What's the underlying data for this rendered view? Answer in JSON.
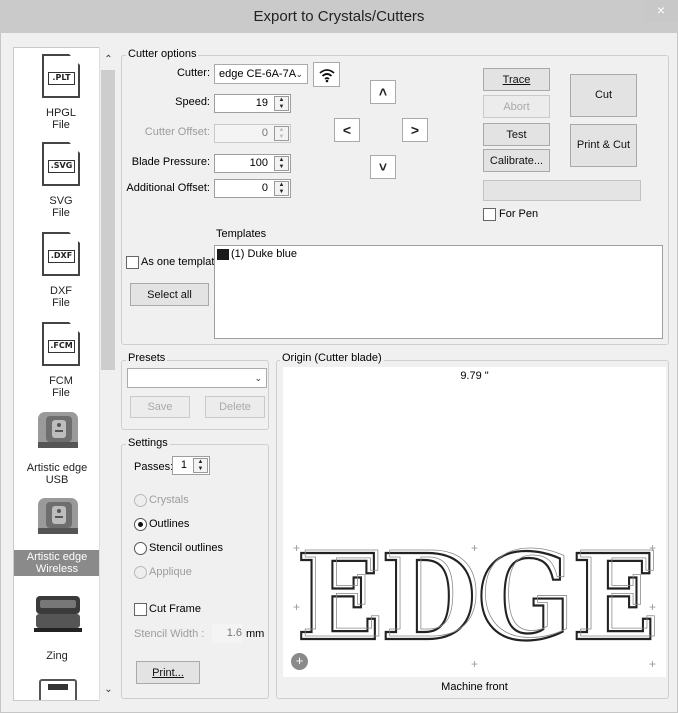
{
  "window": {
    "title": "Export to Crystals/Cutters",
    "close": "×"
  },
  "sidebar": {
    "items": [
      {
        "label": "HPGL",
        "sub": "File",
        "tag": ".PLT"
      },
      {
        "label": "SVG",
        "sub": "File",
        "tag": ".SVG"
      },
      {
        "label": "DXF",
        "sub": "File",
        "tag": ".DXF"
      },
      {
        "label": "FCM",
        "sub": "File",
        "tag": ".FCM"
      },
      {
        "label": "Artistic edge",
        "sub": "USB"
      },
      {
        "label": "Artistic edge",
        "sub": "Wireless",
        "selected": true
      },
      {
        "label": "Zing",
        "sub": ""
      }
    ]
  },
  "cutter_options": {
    "legend": "Cutter options",
    "cutter_label": "Cutter:",
    "cutter_value": "edge CE-6A-7A",
    "speed_label": "Speed:",
    "speed_value": "19",
    "cutter_offset_label": "Cutter Offset:",
    "cutter_offset_value": "0",
    "blade_pressure_label": "Blade Pressure:",
    "blade_pressure_value": "100",
    "additional_offset_label": "Additional Offset:",
    "additional_offset_value": "0",
    "trace": "Trace",
    "abort": "Abort",
    "test": "Test",
    "calibrate": "Calibrate...",
    "cut": "Cut",
    "print_cut": "Print & Cut",
    "for_pen": "For Pen",
    "templates_label": "Templates",
    "as_one_template": "As one template",
    "select_all": "Select all",
    "templates": [
      {
        "label": "(1) Duke blue",
        "color": "#1a1a1a"
      }
    ]
  },
  "presets": {
    "legend": "Presets",
    "value": "",
    "save": "Save",
    "delete": "Delete"
  },
  "settings": {
    "legend": "Settings",
    "passes_label": "Passes:",
    "passes_value": "1",
    "options": [
      "Crystals",
      "Outlines",
      "Stencil outlines",
      "Applique"
    ],
    "selected": "Outlines",
    "cut_frame": "Cut Frame",
    "stencil_width_label": "Stencil Width :",
    "stencil_width_value": "1.6",
    "stencil_width_unit": "mm",
    "print": "Print..."
  },
  "origin": {
    "legend": "Origin (Cutter blade)",
    "width_readout": "9.79 \"",
    "machine_front": "Machine front",
    "design_text": "EDGE"
  }
}
